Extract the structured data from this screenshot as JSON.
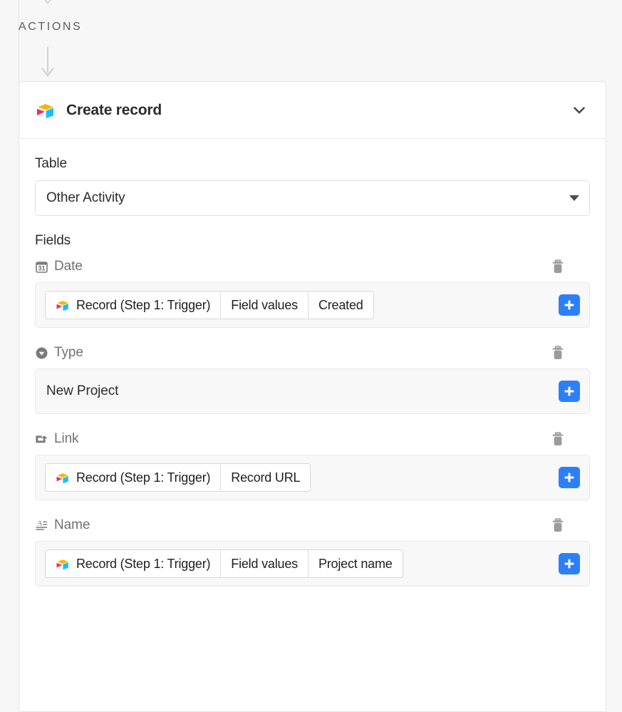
{
  "section": {
    "heading": "ACTIONS"
  },
  "action_card": {
    "app_icon": "airtable-cube-icon",
    "title": "Create record",
    "collapse_icon": "chevron-down-icon",
    "table": {
      "label": "Table",
      "selected": "Other Activity",
      "caret_icon": "triangle-down-icon"
    },
    "fields_label": "Fields",
    "add_button_icon": "plus-icon",
    "delete_button_icon": "trash-icon",
    "accent_color": "#2d7ff9",
    "fields": [
      {
        "name": "Date",
        "icon": "calendar-date-icon",
        "value_type": "token",
        "token_segments": [
          {
            "label": "Record (Step 1: Trigger)",
            "icon": "airtable-cube-icon"
          },
          {
            "label": "Field values"
          },
          {
            "label": "Created"
          }
        ]
      },
      {
        "name": "Type",
        "icon": "single-select-icon",
        "value_type": "text",
        "text": "New Project"
      },
      {
        "name": "Link",
        "icon": "link-to-record-icon",
        "value_type": "token",
        "token_segments": [
          {
            "label": "Record (Step 1: Trigger)",
            "icon": "airtable-cube-icon"
          },
          {
            "label": "Record URL"
          }
        ]
      },
      {
        "name": "Name",
        "icon": "single-line-text-icon",
        "value_type": "token",
        "token_segments": [
          {
            "label": "Record (Step 1: Trigger)",
            "icon": "airtable-cube-icon"
          },
          {
            "label": "Field values"
          },
          {
            "label": "Project name"
          }
        ]
      }
    ]
  }
}
